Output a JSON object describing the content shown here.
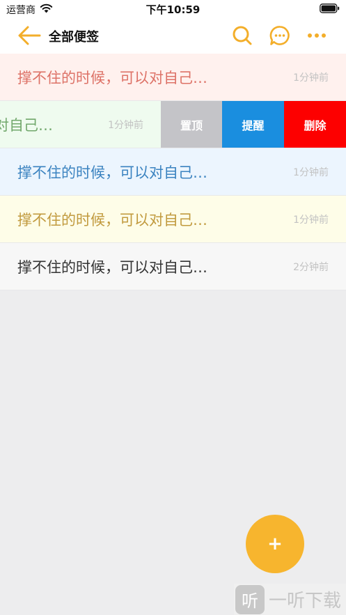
{
  "status_bar": {
    "carrier": "运营商",
    "time": "下午10:59"
  },
  "nav": {
    "title": "全部便签",
    "accent_color": "#f3ae2a"
  },
  "notes": [
    {
      "title": "撑不住的时候，可以对自己…",
      "time": "1分钟前",
      "text_color": "#dd7267",
      "bg_color": "#fff1ee"
    },
    {
      "title": "撑不住的时候，可以对自己…",
      "time": "1分钟前",
      "text_color": "#72a86c",
      "bg_color": "#effbef",
      "swiped": true
    },
    {
      "title": "撑不住的时候，可以对自己…",
      "time": "1分钟前",
      "text_color": "#3b83c0",
      "bg_color": "#ecf5fe"
    },
    {
      "title": "撑不住的时候，可以对自己…",
      "time": "1分钟前",
      "text_color": "#c19a3e",
      "bg_color": "#fefde8"
    },
    {
      "title": "撑不住的时候，可以对自己…",
      "time": "2分钟前",
      "text_color": "#333333",
      "bg_color": "#f7f7f7"
    }
  ],
  "swipe_actions": {
    "pin": "置顶",
    "remind": "提醒",
    "delete": "删除"
  },
  "fab": {
    "label": "+",
    "color": "#f7b52e"
  },
  "watermark": {
    "badge": "听",
    "text": "一听下载"
  }
}
